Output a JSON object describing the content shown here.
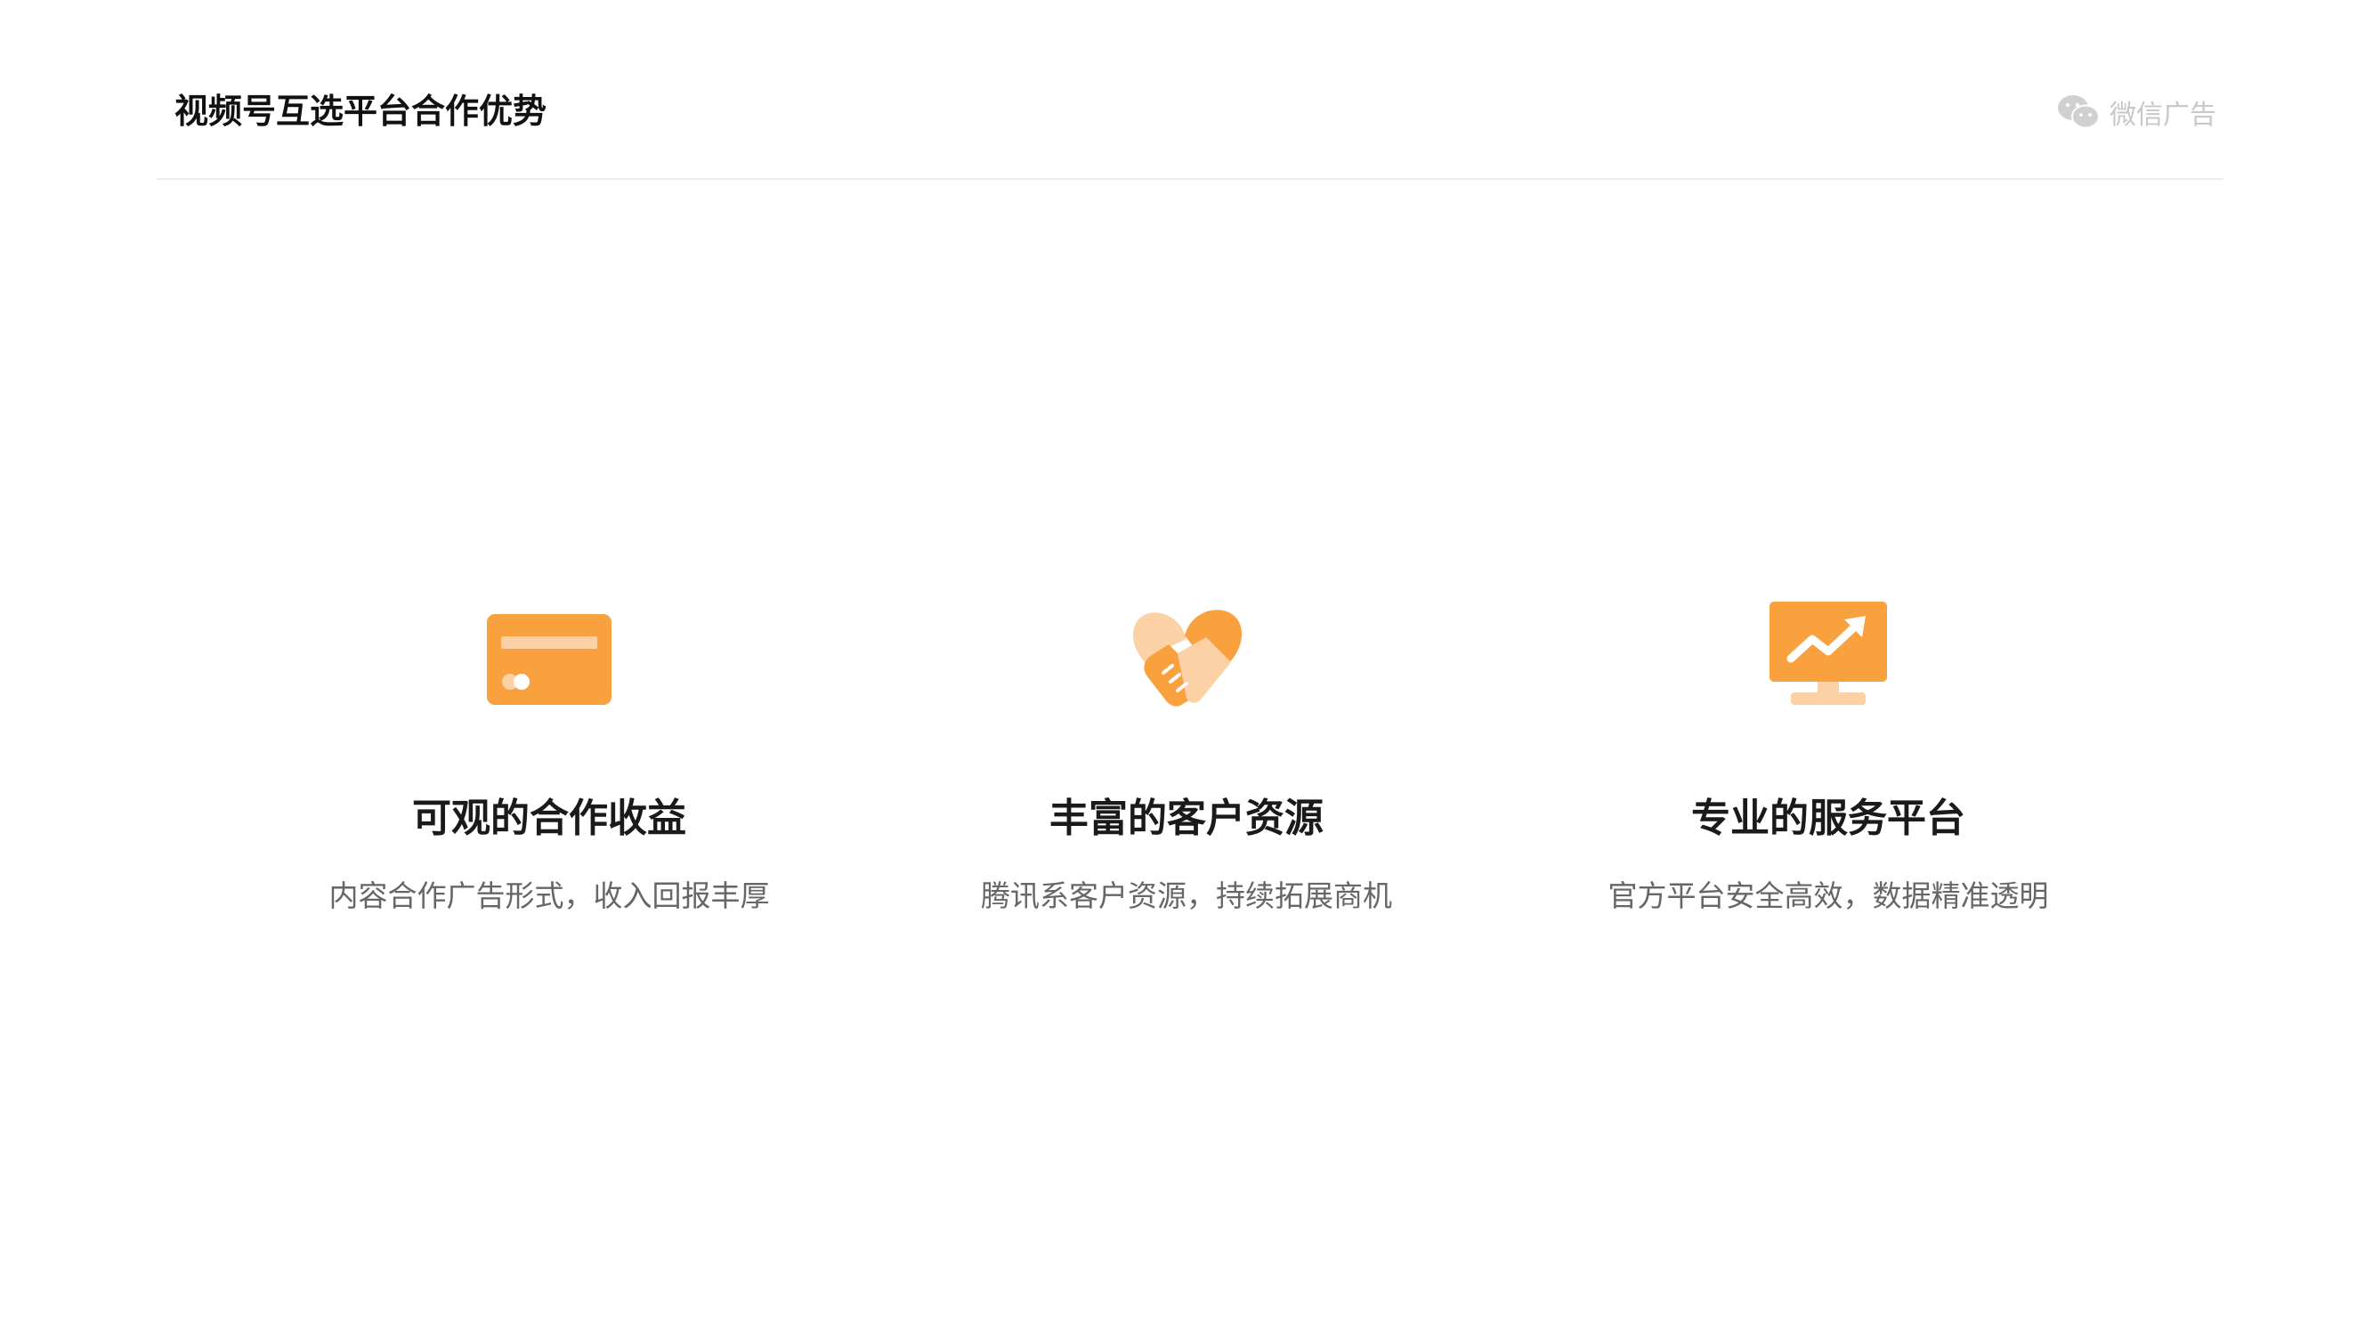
{
  "header": {
    "title": "视频号互选平台合作优势",
    "brand": "微信广告",
    "brand_icon": "wechat-icon"
  },
  "colors": {
    "accent": "#F9A03F",
    "accent_light": "#FDD1A6",
    "divider": "#ECECEC",
    "title_text": "#1A1A1A",
    "desc_text": "#666666",
    "brand_text": "#C8C8C8"
  },
  "features": [
    {
      "icon": "card-icon",
      "title": "可观的合作收益",
      "desc": "内容合作广告形式，收入回报丰厚"
    },
    {
      "icon": "handshake-heart-icon",
      "title": "丰富的客户资源",
      "desc": "腾讯系客户资源，持续拓展商机"
    },
    {
      "icon": "monitor-chart-icon",
      "title": "专业的服务平台",
      "desc": "官方平台安全高效，数据精准透明"
    }
  ]
}
